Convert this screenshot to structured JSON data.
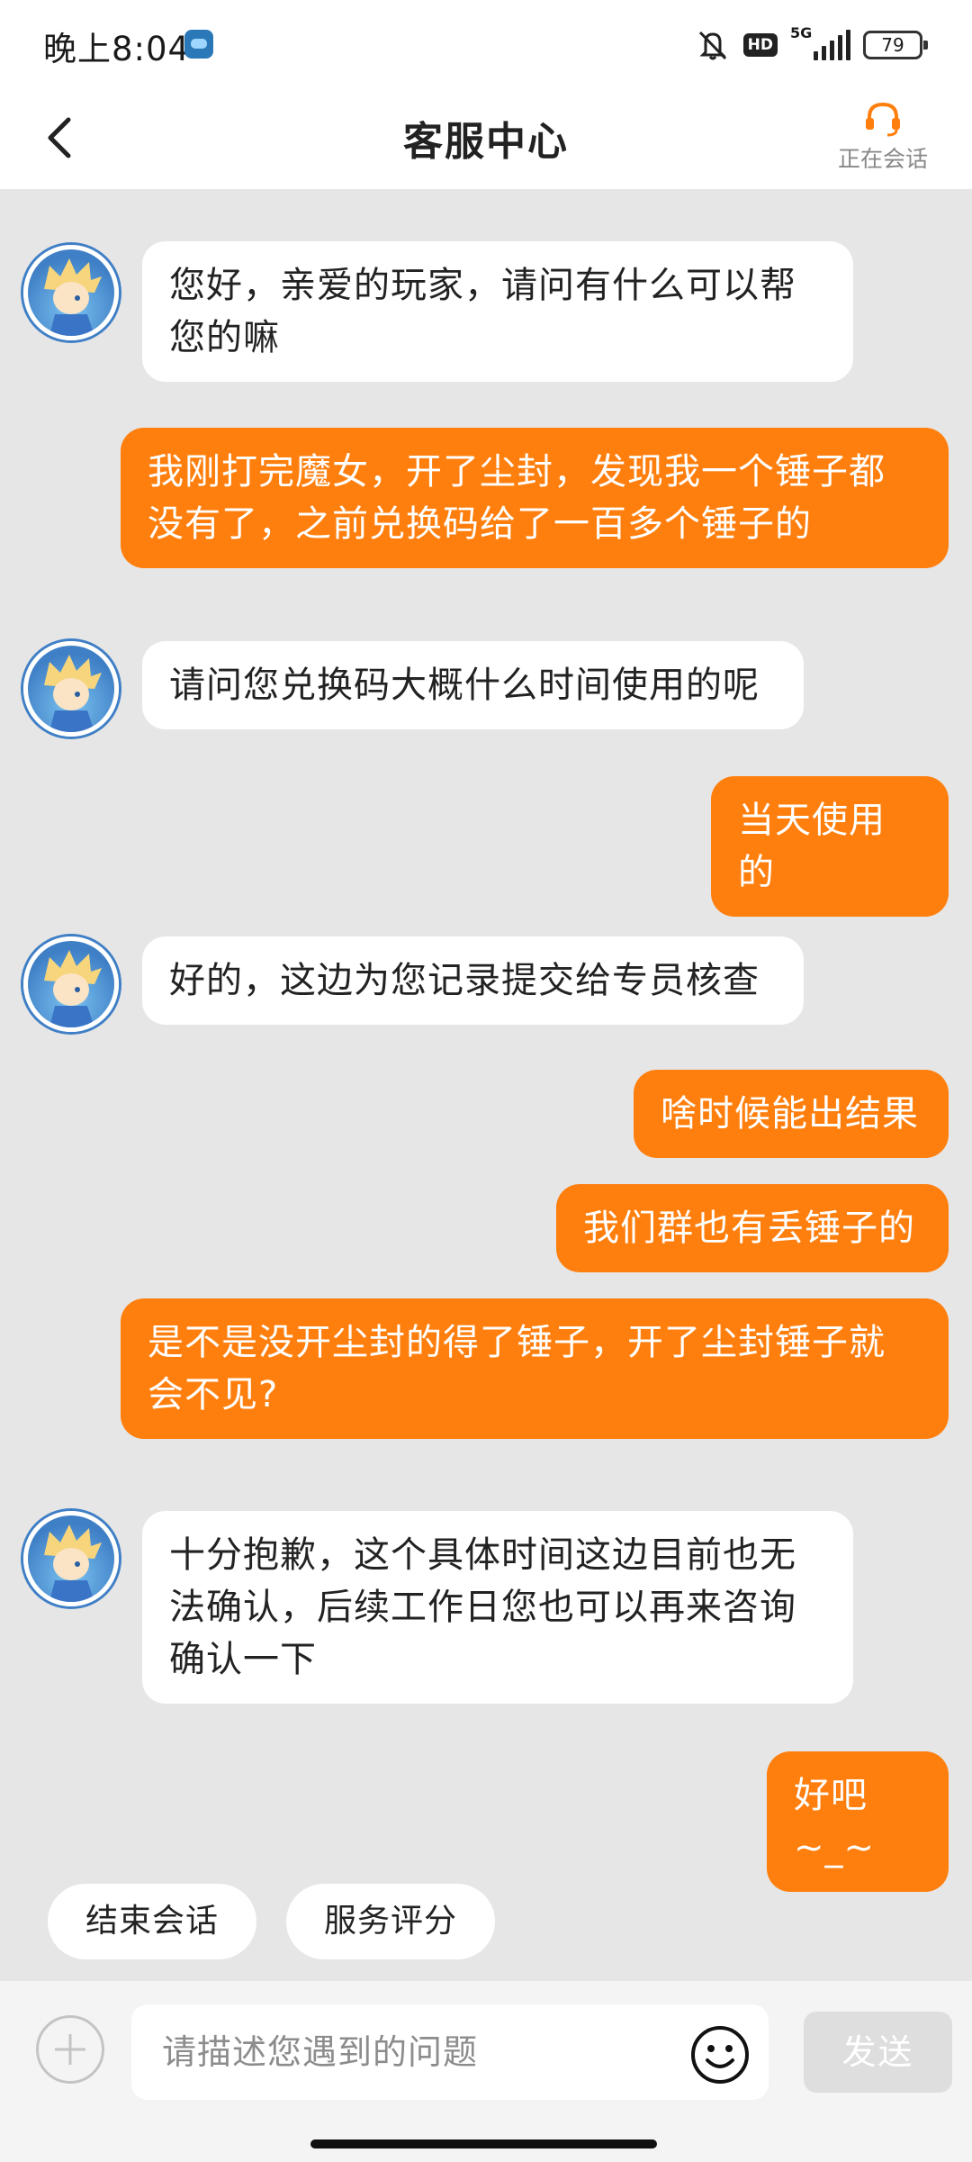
{
  "status_bar": {
    "time": "晚上8:04",
    "network_label": "5G",
    "hd_label": "HD",
    "battery": "79"
  },
  "header": {
    "title": "客服中心",
    "agent_status": "正在会话"
  },
  "messages": [
    {
      "from": "agent",
      "text": "您好，亲爱的玩家，请问有什么可以帮\n您的嘛"
    },
    {
      "from": "user",
      "text": "我刚打完魔女，开了尘封，发现我一个锤子都\n没有了，之前兑换码给了一百多个锤子的"
    },
    {
      "from": "agent",
      "text": "请问您兑换码大概什么时间使用的呢"
    },
    {
      "from": "user",
      "text": "当天使用的"
    },
    {
      "from": "agent",
      "text": "好的，这边为您记录提交给专员核查"
    },
    {
      "from": "user",
      "text": "啥时候能出结果"
    },
    {
      "from": "user",
      "text": "我们群也有丢锤子的"
    },
    {
      "from": "user",
      "text": "是不是没开尘封的得了锤子，开了尘封锤子就\n会不见?"
    },
    {
      "from": "agent",
      "text": "十分抱歉，这个具体时间这边目前也无\n法确认，后续工作日您也可以再来咨询\n确认一下"
    },
    {
      "from": "user",
      "text": "好吧~_~"
    }
  ],
  "quick_actions": {
    "end_session": "结束会话",
    "rate_service": "服务评分"
  },
  "composer": {
    "placeholder": "请描述您遇到的问题",
    "value": "",
    "send_label": "发送"
  },
  "colors": {
    "accent": "#ff7f0e",
    "chat_background": "#e6e6e6",
    "agent_bubble": "#ffffff"
  },
  "icons": {
    "back": "chevron-left-icon",
    "agent": "headset-icon",
    "attach": "plus-icon",
    "emoji": "smiley-icon"
  }
}
